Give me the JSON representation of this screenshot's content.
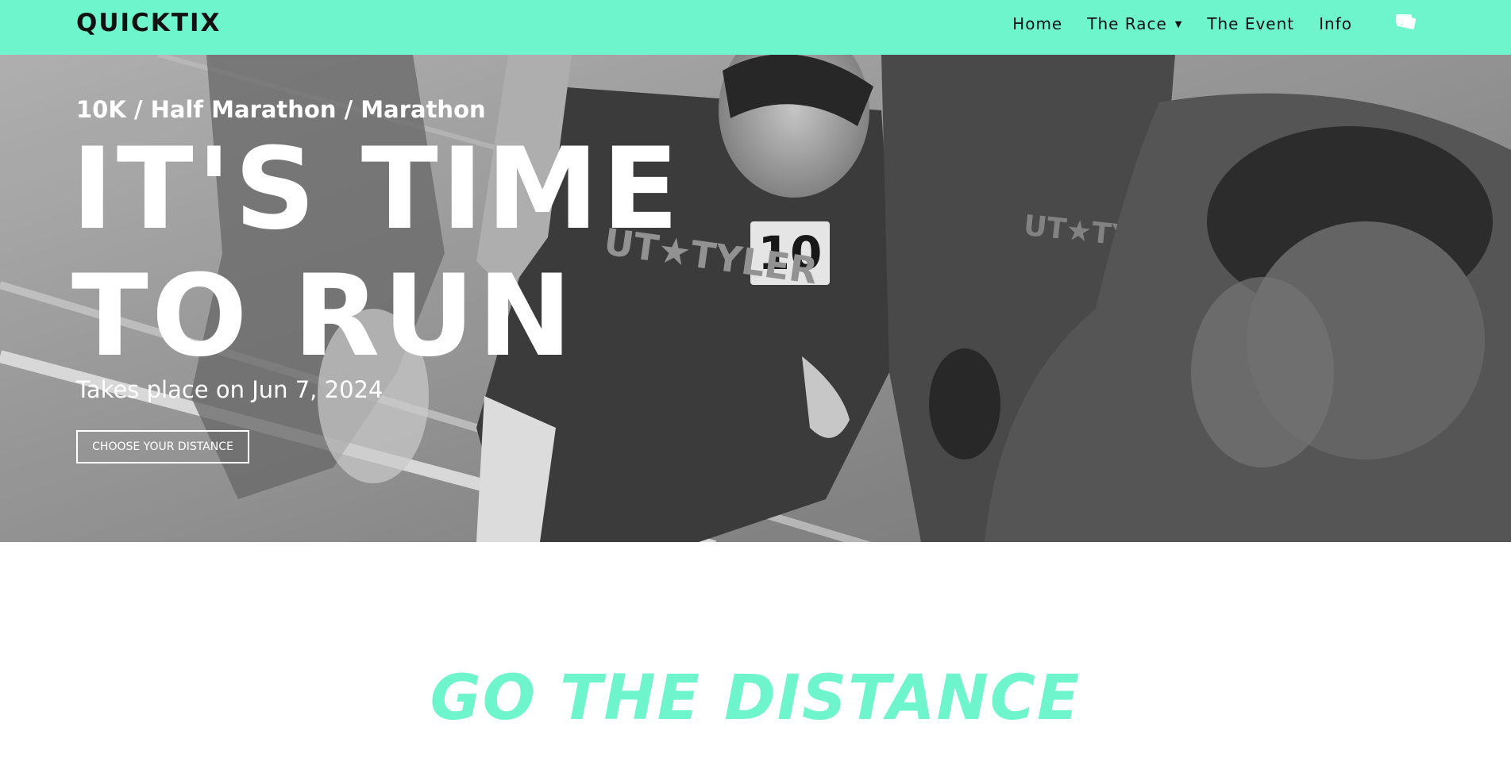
{
  "nav": {
    "brand": "QUICKTIX",
    "links": [
      {
        "label": "Home"
      },
      {
        "label": "The Race",
        "has_dropdown": true
      },
      {
        "label": "The Event"
      },
      {
        "label": "Info"
      }
    ],
    "cart_icon": "ticket-icon",
    "dropdown_icon": "caret-down-icon"
  },
  "hero": {
    "subtitle": "10K / Half Marathon / Marathon",
    "title_line_1": "IT'S TIME",
    "title_line_2": "TO RUN",
    "date_text": "Takes place on Jun 7, 2024",
    "cta_label": "CHOOSE YOUR DISTANCE",
    "background": "grayscale photo of runners at race start"
  },
  "section": {
    "title": "GO THE DISTANCE"
  },
  "colors": {
    "accent": "#6ef5cc",
    "text_dark": "#111111",
    "white": "#ffffff"
  }
}
